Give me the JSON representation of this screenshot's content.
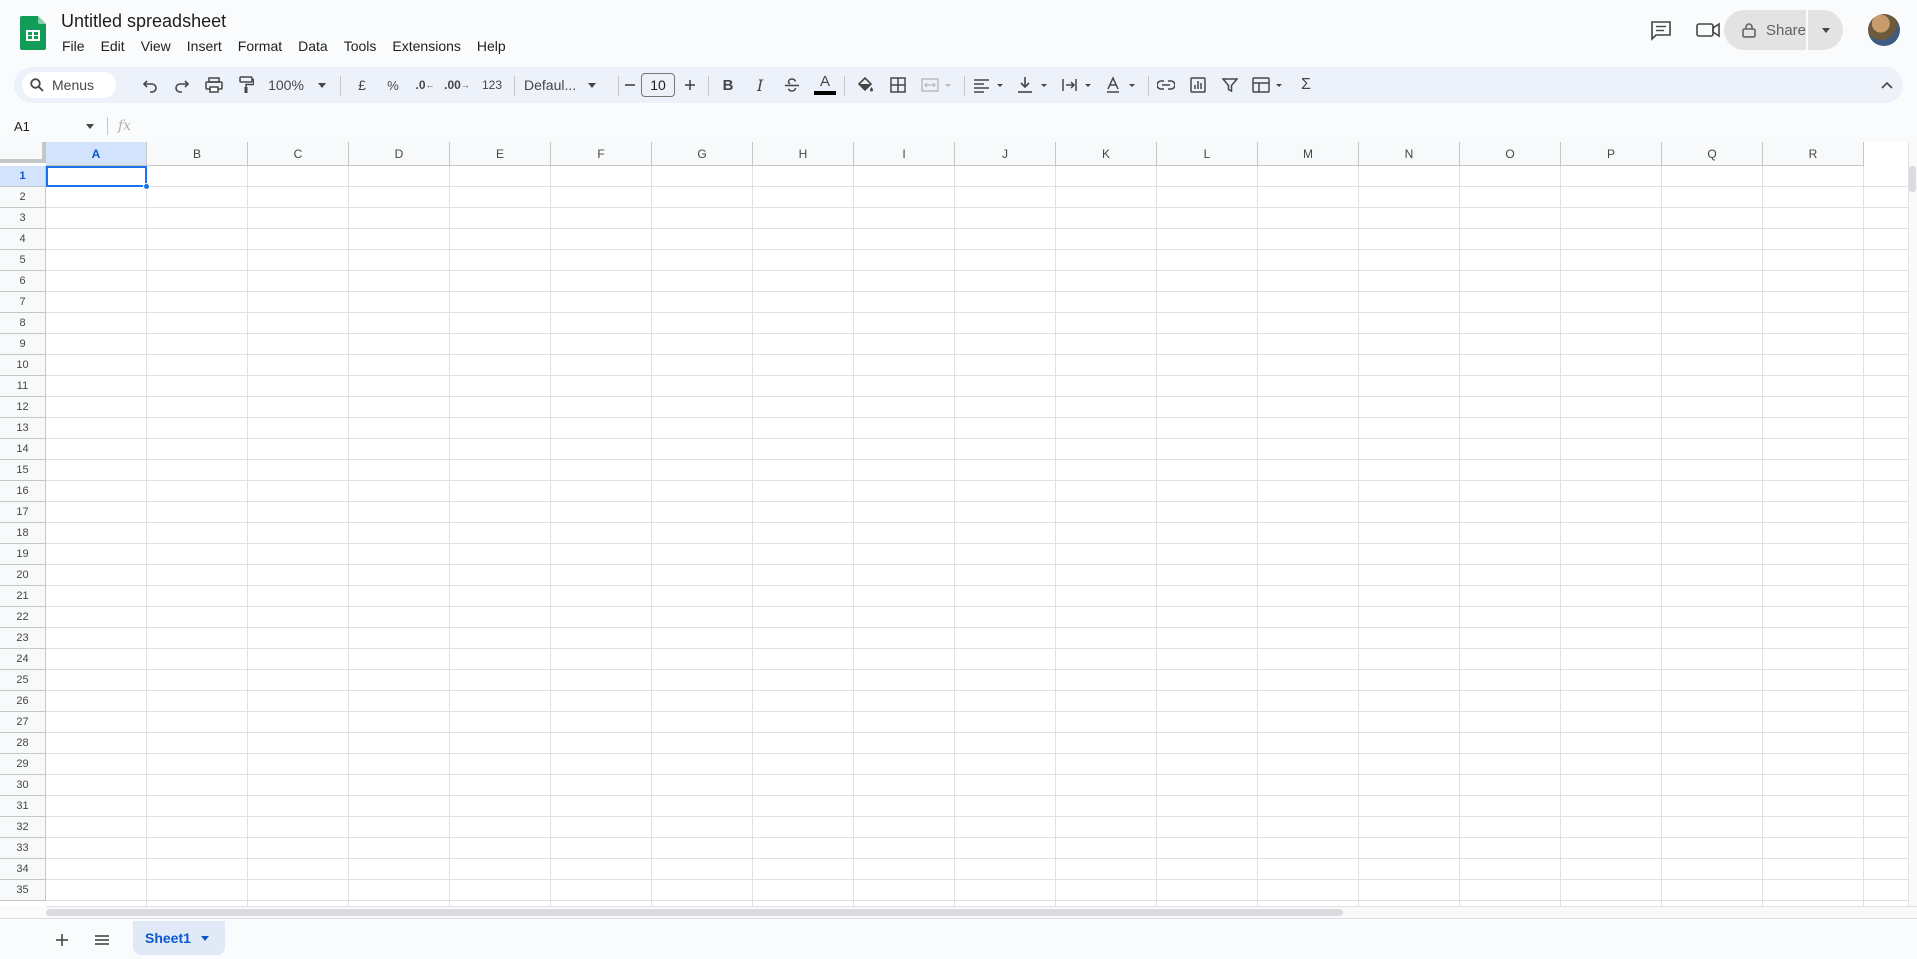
{
  "app": {
    "title": "Untitled spreadsheet",
    "brand_color": "#0f9d58",
    "accent_color": "#1a73e8"
  },
  "menubar": {
    "items": [
      "File",
      "Edit",
      "View",
      "Insert",
      "Format",
      "Data",
      "Tools",
      "Extensions",
      "Help"
    ]
  },
  "header": {
    "share_label": "Share",
    "icons": [
      "comment-icon",
      "meet-video-icon",
      "lock-icon",
      "avatar"
    ]
  },
  "toolbar": {
    "search_label": "Menus",
    "zoom": "100%",
    "currency": "£",
    "percent": "%",
    "decrease_decimal": ".0",
    "increase_decimal": ".00",
    "more_formats": "123",
    "font": "Defaul...",
    "font_size": "10",
    "icons": [
      "undo-icon",
      "redo-icon",
      "print-icon",
      "paint-format-icon",
      "bold-icon",
      "italic-icon",
      "strikethrough-icon",
      "text-color-icon",
      "fill-color-icon",
      "borders-icon",
      "merge-cells-icon",
      "horizontal-align-icon",
      "vertical-align-icon",
      "text-wrap-icon",
      "text-rotation-icon",
      "link-icon",
      "comment-insert-icon",
      "filter-icon",
      "filter-views-icon",
      "functions-icon",
      "collapse-icon"
    ]
  },
  "formula_bar": {
    "name_box": "A1",
    "fx_label": "fx",
    "value": ""
  },
  "grid": {
    "columns": [
      "A",
      "B",
      "C",
      "D",
      "E",
      "F",
      "G",
      "H",
      "I",
      "J",
      "K",
      "L",
      "M",
      "N",
      "O",
      "P",
      "Q",
      "R"
    ],
    "rows": [
      "1",
      "2",
      "3",
      "4",
      "5",
      "6",
      "7",
      "8",
      "9",
      "10",
      "11",
      "12",
      "13",
      "14",
      "15",
      "16",
      "17",
      "18",
      "19",
      "20",
      "21",
      "22",
      "23",
      "24",
      "25",
      "26",
      "27",
      "28",
      "29",
      "30",
      "31",
      "32",
      "33",
      "34",
      "35"
    ],
    "selected_cell": "A1"
  },
  "sheets": {
    "tabs": [
      {
        "label": "Sheet1",
        "active": true
      }
    ]
  }
}
